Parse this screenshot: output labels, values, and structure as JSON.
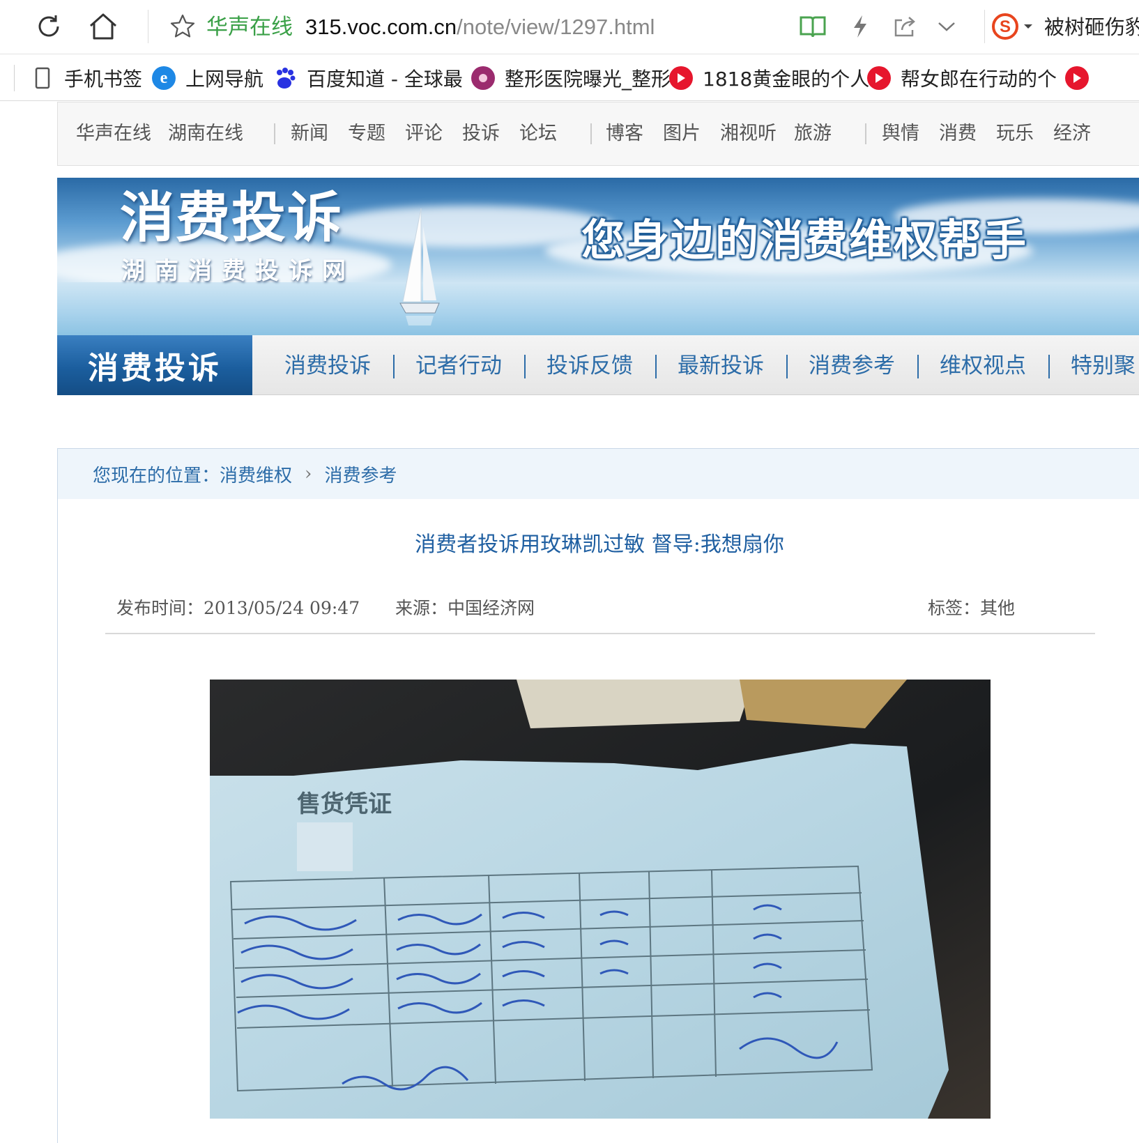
{
  "browser": {
    "site_name": "华声在线",
    "url_domain": "315.voc.com.cn",
    "url_path": "/note/view/1297.html",
    "search_hint": "被树砸伤豹",
    "bookmarks": [
      {
        "label": "手机书签",
        "icon": "phone-icon"
      },
      {
        "label": "上网导航",
        "icon": "ie-icon"
      },
      {
        "label": "百度知道 - 全球最",
        "icon": "baidu-paw-icon"
      },
      {
        "label": "整形医院曝光_整形",
        "icon": "clinic-logo-icon"
      },
      {
        "label": "1818黄金眼的个人",
        "icon": "weibo-video-icon"
      },
      {
        "label": "帮女郎在行动的个",
        "icon": "weibo-video-icon"
      }
    ]
  },
  "site_nav": {
    "group1": [
      "华声在线",
      "湖南在线"
    ],
    "group2": [
      "新闻",
      "专题",
      "评论",
      "投诉",
      "论坛"
    ],
    "group3": [
      "博客",
      "图片",
      "湘视听",
      "旅游"
    ],
    "group4": [
      "舆情",
      "消费",
      "玩乐",
      "经济"
    ]
  },
  "banner": {
    "title": "消费投诉",
    "subtitle": "湖南消费投诉网",
    "slogan": "您身边的消费维权帮手"
  },
  "channel": {
    "badge": "消费投诉",
    "items": [
      "消费投诉",
      "记者行动",
      "投诉反馈",
      "最新投诉",
      "消费参考",
      "维权视点",
      "特别聚"
    ]
  },
  "breadcrumb": {
    "prefix": "您现在的位置：",
    "level1": "消费维权",
    "level2": "消费参考"
  },
  "article": {
    "title": "消费者投诉用玫琳凯过敏  督导:我想扇你",
    "publish_label": "发布时间：",
    "publish_time": "2013/05/24 09:47",
    "source_label": "来源：",
    "source": "中国经济网",
    "tag_label": "标签：",
    "tag": "其他",
    "receipt_heading": "售货凭证"
  }
}
